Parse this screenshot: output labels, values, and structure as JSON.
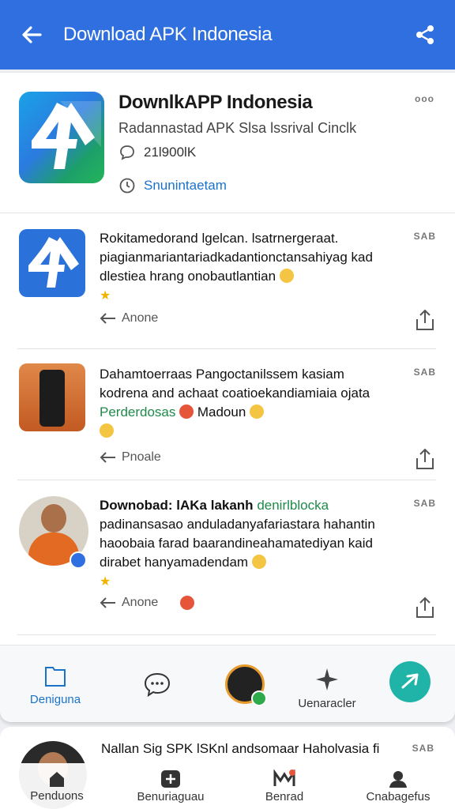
{
  "header": {
    "title": "Download APK Indonesia"
  },
  "app": {
    "name": "DownlkAPP Indonesia",
    "subtitle": "Radannastad APK Slsa lssrival Cinclk",
    "comments": "21l900lK",
    "status": "Snunintaetam",
    "menu": "ooo"
  },
  "feed": [
    {
      "tag": "SAB",
      "lines": [
        "Rokitamedorand lgelcan. lsatrnergeraat.",
        "piagianmariantariadkadantionctansahiyag kad",
        "dlestiea hrang onobautlantian"
      ],
      "reply": "Anone"
    },
    {
      "tag": "SAB",
      "lines": [
        "Dahamtoerraas Pangoctanilssem kasiam",
        "kodrena and achaat coatioekandiamiaia ojata"
      ],
      "tags_line": [
        "Perderdosas",
        "Madoun"
      ],
      "reply": "Pnoale"
    },
    {
      "tag": "SAB",
      "headline": "Downobad: lAKa lakanh",
      "headline_highlight": "denirlblocka",
      "lines": [
        "padinansasao anduladanyafariastara hahantin",
        "haoobaia farad baarandineahamatediyan kaid",
        "dirabet hanyamadendam"
      ],
      "reply": "Anone"
    }
  ],
  "actionbar": {
    "items": [
      {
        "label": "Deniguna"
      },
      {
        "label": ""
      },
      {
        "label": ""
      },
      {
        "label": "Uenaracler"
      }
    ]
  },
  "next": {
    "text": "Nallan Sig SPK lSKnl andsomaar Haholvasia fi",
    "tag": "SAB"
  },
  "bottomnav": {
    "items": [
      {
        "label": "Penduons"
      },
      {
        "label": "Benuriaguau"
      },
      {
        "label": "Benrad"
      },
      {
        "label": "Cnabagefus"
      }
    ]
  },
  "colors": {
    "primary": "#2f6fe0",
    "accent": "#20b3a8",
    "link": "#1a73c9",
    "highlight": "#1f8a4a"
  }
}
